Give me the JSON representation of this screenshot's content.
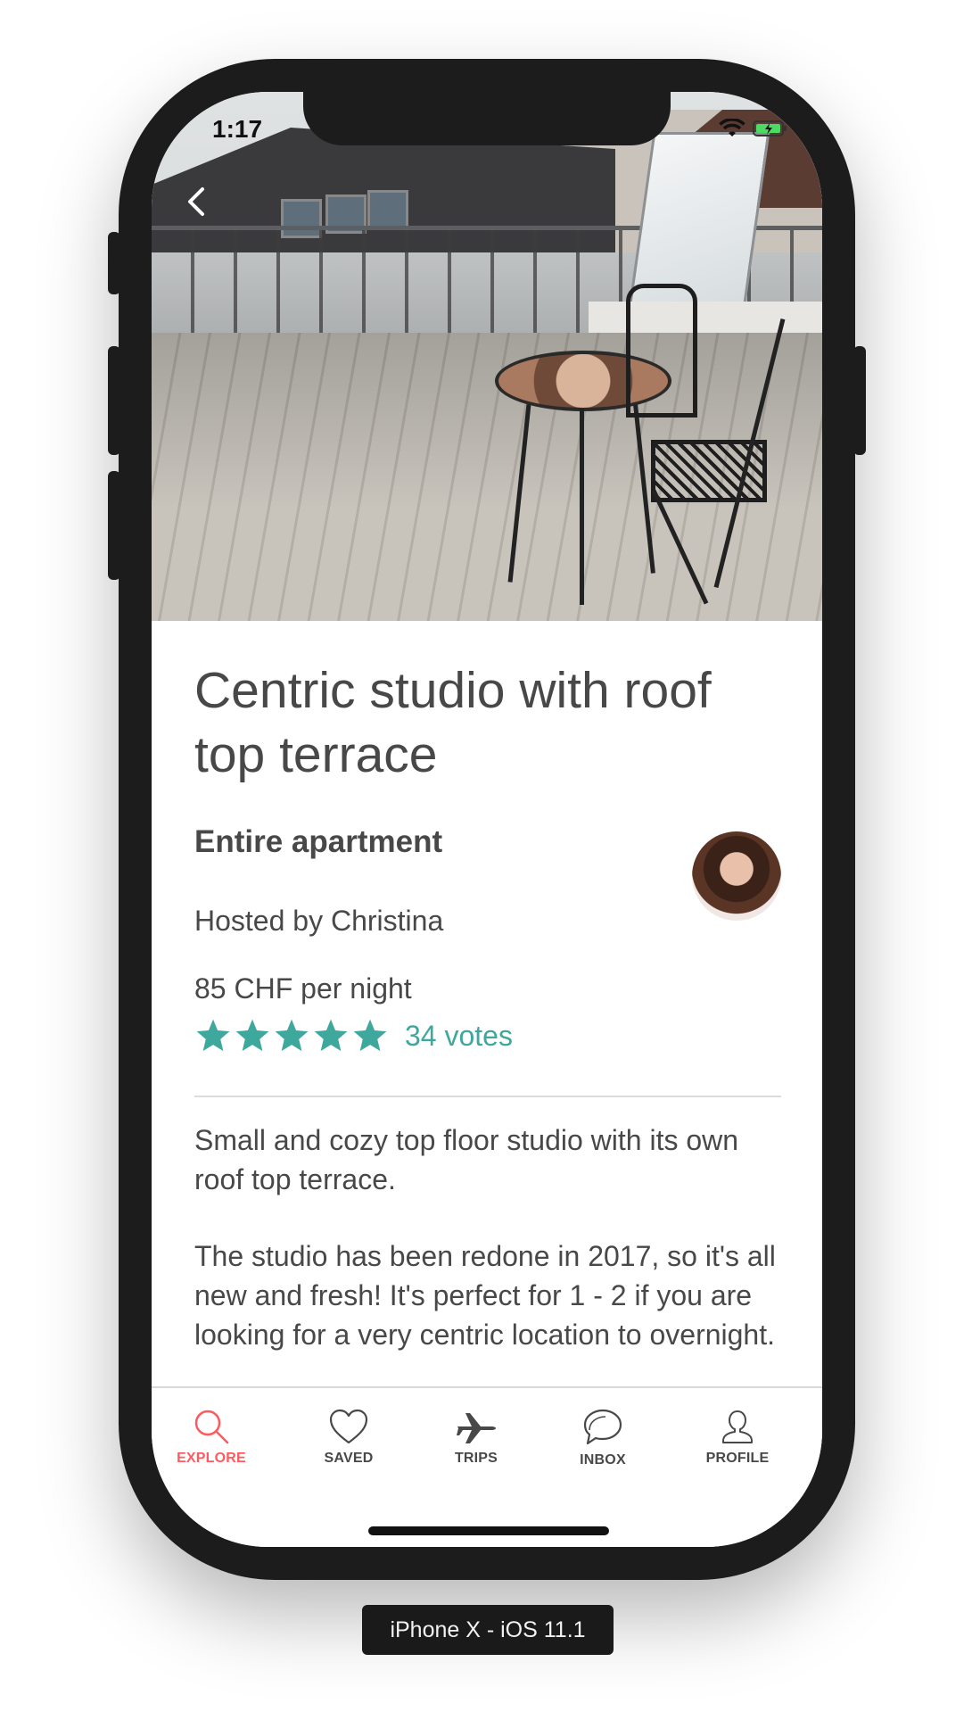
{
  "status_bar": {
    "time": "1:17"
  },
  "listing": {
    "title": "Centric studio with roof top terrace",
    "room_type": "Entire apartment",
    "host": "Hosted by Christina",
    "price": "85 CHF per night",
    "rating": {
      "stars": 5,
      "votes": "34 votes"
    },
    "description": [
      "Small and cozy top floor studio with its own roof top terrace.",
      "The studio has been redone in 2017, so it's all new and fresh! It's perfect for 1 - 2 if you are looking for a very centric location to overnight."
    ]
  },
  "tabs": [
    {
      "label": "EXPLORE",
      "icon": "search-icon",
      "active": true
    },
    {
      "label": "SAVED",
      "icon": "heart-icon",
      "active": false
    },
    {
      "label": "TRIPS",
      "icon": "airplane-icon",
      "active": false
    },
    {
      "label": "INBOX",
      "icon": "chat-bubble-icon",
      "active": false
    },
    {
      "label": "PROFILE",
      "icon": "person-icon",
      "active": false
    }
  ],
  "colors": {
    "accent": "#ff5a5f",
    "rating": "#3fa89d",
    "text": "#484848"
  },
  "device_label": "iPhone X - iOS 11.1"
}
